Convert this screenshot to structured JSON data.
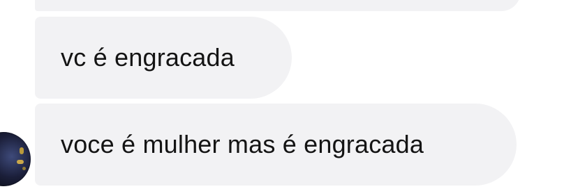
{
  "chat": {
    "messages": [
      {
        "text": ""
      },
      {
        "text": "vc é engracada"
      },
      {
        "text": "voce é mulher mas é engracada"
      }
    ],
    "sender_avatar": {
      "icon": "profile-photo",
      "alt": ""
    }
  },
  "colors": {
    "bubble_background": "#f2f2f4",
    "text": "#141414",
    "page_background": "#ffffff"
  }
}
